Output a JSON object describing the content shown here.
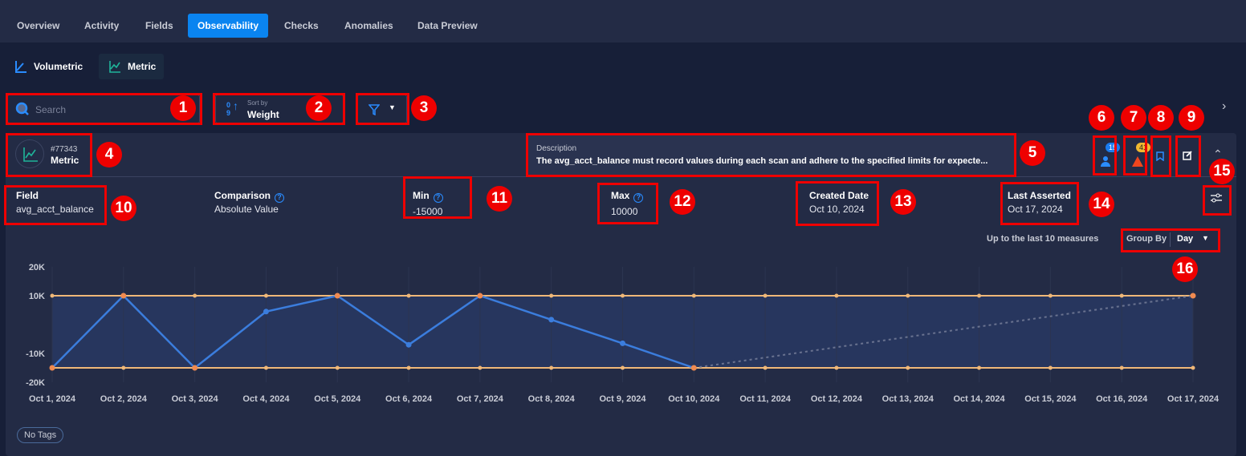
{
  "tabs": [
    "Overview",
    "Activity",
    "Fields",
    "Observability",
    "Checks",
    "Anomalies",
    "Data Preview"
  ],
  "active_tab": "Observability",
  "subtabs": [
    "Volumetric",
    "Metric"
  ],
  "search": {
    "placeholder": "Search"
  },
  "sort": {
    "label": "Sort by",
    "value": "Weight"
  },
  "check": {
    "id": "#77343",
    "type": "Metric",
    "description_label": "Description",
    "description": "The avg_acct_balance must record values during each scan and adhere to the specified limits for expecte...",
    "owners_count": "15",
    "anomalies_count": "41"
  },
  "details": {
    "field": {
      "label": "Field",
      "value": "avg_acct_balance"
    },
    "comparison": {
      "label": "Comparison",
      "value": "Absolute Value"
    },
    "min": {
      "label": "Min",
      "value": "-15000"
    },
    "max": {
      "label": "Max",
      "value": "10000"
    },
    "created": {
      "label": "Created Date",
      "value": "Oct 10, 2024"
    },
    "asserted": {
      "label": "Last Asserted",
      "value": "Oct 17, 2024"
    }
  },
  "chart_controls": {
    "measures_text": "Up to the last 10 measures",
    "group_by_label": "Group By",
    "group_by_value": "Day"
  },
  "tags": {
    "empty_label": "No Tags"
  },
  "colors": {
    "accent": "#0a84f0",
    "line": "#3b7ddd",
    "limit": "#f0b878",
    "teal": "#1fb59a"
  },
  "annotations": [
    "1",
    "2",
    "3",
    "4",
    "5",
    "6",
    "7",
    "8",
    "9",
    "10",
    "11",
    "12",
    "13",
    "14",
    "15",
    "16"
  ],
  "chart_data": {
    "type": "line",
    "x": [
      "Oct 1, 2024",
      "Oct 2, 2024",
      "Oct 3, 2024",
      "Oct 4, 2024",
      "Oct 5, 2024",
      "Oct 6, 2024",
      "Oct 7, 2024",
      "Oct 8, 2024",
      "Oct 9, 2024",
      "Oct 10, 2024",
      "Oct 11, 2024",
      "Oct 12, 2024",
      "Oct 13, 2024",
      "Oct 14, 2024",
      "Oct 15, 2024",
      "Oct 16, 2024",
      "Oct 17, 2024"
    ],
    "values": [
      -15000,
      10000,
      -15000,
      4500,
      10000,
      -7000,
      10000,
      1700,
      -6500,
      -15000
    ],
    "projection": {
      "from": [
        "Oct 10, 2024",
        -15000
      ],
      "to": [
        "Oct 17, 2024",
        10000
      ]
    },
    "max_limit": 10000,
    "min_limit": -15000,
    "yticks": [
      {
        "v": 20000,
        "label": "20K"
      },
      {
        "v": 10000,
        "label": "10K"
      },
      {
        "v": -10000,
        "label": "-10K"
      },
      {
        "v": -20000,
        "label": "-20K"
      }
    ],
    "ylim": [
      -20000,
      20000
    ]
  }
}
